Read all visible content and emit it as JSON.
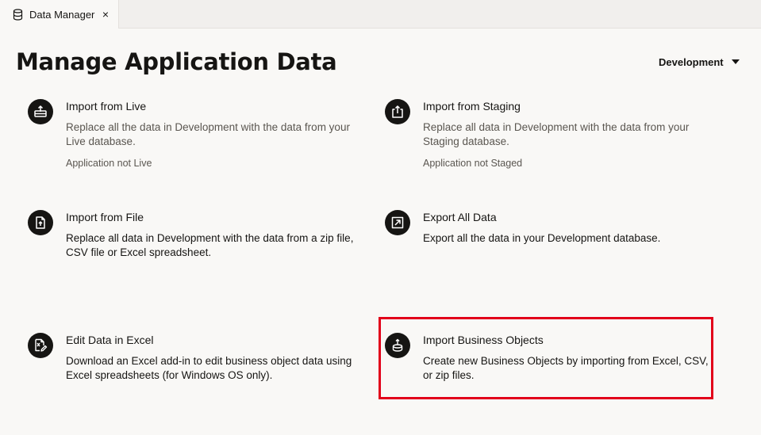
{
  "tab": {
    "label": "Data Manager",
    "close": "×"
  },
  "page": {
    "title": "Manage Application Data"
  },
  "environment": {
    "selected": "Development"
  },
  "cards": {
    "import_live": {
      "title": "Import from Live",
      "description": "Replace all the data in Development with the data from your Live database.",
      "note": "Application not Live"
    },
    "import_staging": {
      "title": "Import from Staging",
      "description": "Replace all data in Development with the data from your Staging database.",
      "note": "Application not Staged"
    },
    "import_file": {
      "title": "Import from File",
      "description": "Replace all data in Development with the data from a zip file, CSV file or Excel spreadsheet."
    },
    "export_all": {
      "title": "Export All Data",
      "description": "Export all the data in your Development database."
    },
    "edit_excel": {
      "title": "Edit Data in Excel",
      "description": "Download an Excel add-in to edit business object data using Excel spreadsheets (for Windows OS only)."
    },
    "import_bo": {
      "title": "Import Business Objects",
      "description": "Create new Business Objects by importing from Excel, CSV, or zip files."
    }
  },
  "colors": {
    "highlight": "#e2001a",
    "icon_bg": "#161513",
    "background": "#f9f8f6"
  }
}
